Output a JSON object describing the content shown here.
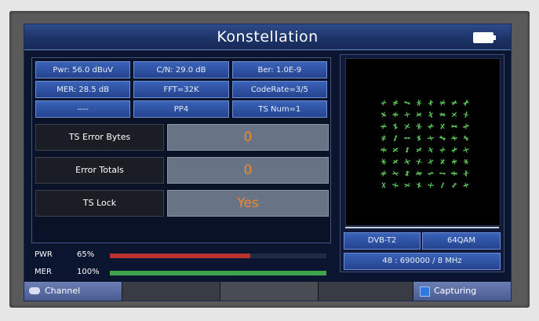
{
  "title": "Konstellation",
  "battery_icon": "battery-full-icon",
  "params": [
    "Pwr: 56.0 dBuV",
    "C/N: 29.0 dB",
    "Ber: 1.0E-9",
    "MER: 28.5 dB",
    "FFT=32K",
    "CodeRate=3/5",
    "----",
    "PP4",
    "TS Num=1"
  ],
  "stats": [
    {
      "label": "TS Error Bytes",
      "value": "0"
    },
    {
      "label": "Error Totals",
      "value": "0"
    },
    {
      "label": "TS Lock",
      "value": "Yes"
    }
  ],
  "bars": [
    {
      "label": "PWR",
      "percent_text": "65%",
      "level": 0.65,
      "color": "#b8322e"
    },
    {
      "label": "MER",
      "percent_text": "100%",
      "level": 1.0,
      "color": "#3fa54a"
    }
  ],
  "modes": {
    "standard": "DVB-T2",
    "modulation": "64QAM",
    "frequency": "48 : 690000 / 8 MHz"
  },
  "constellation": {
    "order": 64,
    "color": "#5fd35c"
  },
  "footer": {
    "channel": "Channel",
    "capturing": "Capturing"
  }
}
